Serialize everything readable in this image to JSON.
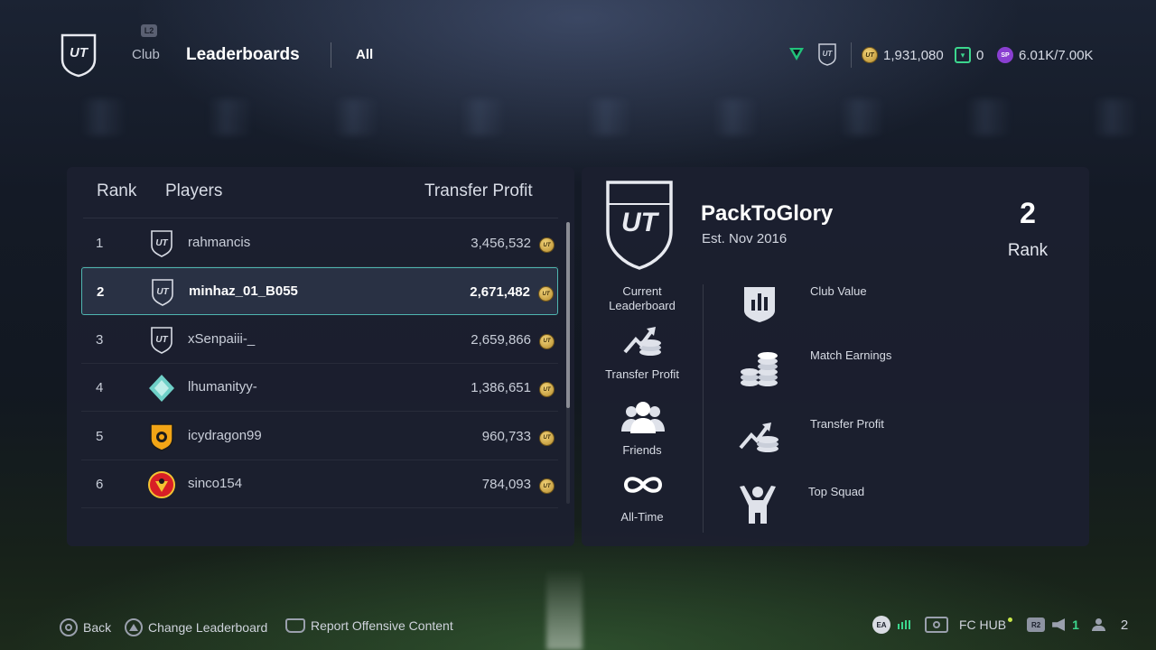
{
  "header": {
    "l2_hint": "L2",
    "nav_club": "Club",
    "nav_leaderboards": "Leaderboards",
    "filter_all": "All",
    "ut_logo": "UT",
    "coins": "1,931,080",
    "fc_points": "0",
    "sp": "6.01K/7.00K",
    "sp_icon_text": "SP"
  },
  "leaderboard": {
    "col_rank": "Rank",
    "col_players": "Players",
    "col_metric": "Transfer Profit",
    "rows": [
      {
        "rank": "1",
        "name": "rahmancis",
        "value": "3,456,532",
        "crest": "ut-shield-icon"
      },
      {
        "rank": "2",
        "name": "minhaz_01_B055",
        "value": "2,671,482",
        "crest": "ut-shield-icon"
      },
      {
        "rank": "3",
        "name": "xSenpaiii-_",
        "value": "2,659,866",
        "crest": "ut-shield-icon"
      },
      {
        "rank": "4",
        "name": "lhumanityy-",
        "value": "1,386,651",
        "crest": "diamond-crest-icon"
      },
      {
        "rank": "5",
        "name": "icydragon99",
        "value": "960,733",
        "crest": "hull-city-crest-icon"
      },
      {
        "rank": "6",
        "name": "sinco154",
        "value": "784,093",
        "crest": "man-utd-crest-icon"
      }
    ]
  },
  "club": {
    "name": "PackToGlory",
    "established": "Est. Nov 2016",
    "rank_value": "2",
    "rank_label": "Rank",
    "current_leaderboard_label": "Current Leaderboard",
    "current_selection": "Transfer Profit",
    "scope_friends": "Friends",
    "scope_all_time": "All-Time",
    "leaderboards": [
      {
        "label": "Club Value",
        "icon": "club-value-icon"
      },
      {
        "label": "Match Earnings",
        "icon": "coin-stack-icon"
      },
      {
        "label": "Transfer Profit",
        "icon": "transfer-profit-icon"
      },
      {
        "label": "Top Squad",
        "icon": "top-squad-icon"
      }
    ]
  },
  "footer": {
    "back": "Back",
    "change_leaderboard": "Change Leaderboard",
    "report": "Report Offensive Content",
    "ea": "EA",
    "fc_hub": "FC HUB",
    "r2": "R2",
    "online_count": "1",
    "party_count": "2"
  },
  "colors": {
    "accent_teal": "#4fb6b0",
    "fc_green": "#3cd68d",
    "coin_gold": "#d9b24a",
    "sp_purple": "#8a3fd1"
  }
}
